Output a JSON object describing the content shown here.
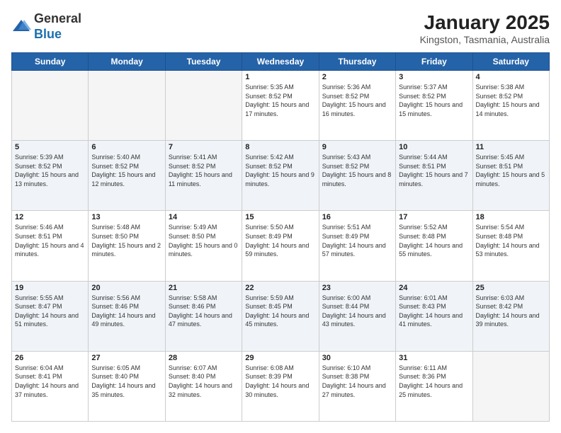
{
  "header": {
    "logo_general": "General",
    "logo_blue": "Blue",
    "title": "January 2025",
    "subtitle": "Kingston, Tasmania, Australia"
  },
  "days_of_week": [
    "Sunday",
    "Monday",
    "Tuesday",
    "Wednesday",
    "Thursday",
    "Friday",
    "Saturday"
  ],
  "weeks": [
    [
      {
        "day": "",
        "empty": true
      },
      {
        "day": "",
        "empty": true
      },
      {
        "day": "",
        "empty": true
      },
      {
        "day": "1",
        "sunrise": "Sunrise: 5:35 AM",
        "sunset": "Sunset: 8:52 PM",
        "daylight": "Daylight: 15 hours and 17 minutes."
      },
      {
        "day": "2",
        "sunrise": "Sunrise: 5:36 AM",
        "sunset": "Sunset: 8:52 PM",
        "daylight": "Daylight: 15 hours and 16 minutes."
      },
      {
        "day": "3",
        "sunrise": "Sunrise: 5:37 AM",
        "sunset": "Sunset: 8:52 PM",
        "daylight": "Daylight: 15 hours and 15 minutes."
      },
      {
        "day": "4",
        "sunrise": "Sunrise: 5:38 AM",
        "sunset": "Sunset: 8:52 PM",
        "daylight": "Daylight: 15 hours and 14 minutes."
      }
    ],
    [
      {
        "day": "5",
        "sunrise": "Sunrise: 5:39 AM",
        "sunset": "Sunset: 8:52 PM",
        "daylight": "Daylight: 15 hours and 13 minutes."
      },
      {
        "day": "6",
        "sunrise": "Sunrise: 5:40 AM",
        "sunset": "Sunset: 8:52 PM",
        "daylight": "Daylight: 15 hours and 12 minutes."
      },
      {
        "day": "7",
        "sunrise": "Sunrise: 5:41 AM",
        "sunset": "Sunset: 8:52 PM",
        "daylight": "Daylight: 15 hours and 11 minutes."
      },
      {
        "day": "8",
        "sunrise": "Sunrise: 5:42 AM",
        "sunset": "Sunset: 8:52 PM",
        "daylight": "Daylight: 15 hours and 9 minutes."
      },
      {
        "day": "9",
        "sunrise": "Sunrise: 5:43 AM",
        "sunset": "Sunset: 8:52 PM",
        "daylight": "Daylight: 15 hours and 8 minutes."
      },
      {
        "day": "10",
        "sunrise": "Sunrise: 5:44 AM",
        "sunset": "Sunset: 8:51 PM",
        "daylight": "Daylight: 15 hours and 7 minutes."
      },
      {
        "day": "11",
        "sunrise": "Sunrise: 5:45 AM",
        "sunset": "Sunset: 8:51 PM",
        "daylight": "Daylight: 15 hours and 5 minutes."
      }
    ],
    [
      {
        "day": "12",
        "sunrise": "Sunrise: 5:46 AM",
        "sunset": "Sunset: 8:51 PM",
        "daylight": "Daylight: 15 hours and 4 minutes."
      },
      {
        "day": "13",
        "sunrise": "Sunrise: 5:48 AM",
        "sunset": "Sunset: 8:50 PM",
        "daylight": "Daylight: 15 hours and 2 minutes."
      },
      {
        "day": "14",
        "sunrise": "Sunrise: 5:49 AM",
        "sunset": "Sunset: 8:50 PM",
        "daylight": "Daylight: 15 hours and 0 minutes."
      },
      {
        "day": "15",
        "sunrise": "Sunrise: 5:50 AM",
        "sunset": "Sunset: 8:49 PM",
        "daylight": "Daylight: 14 hours and 59 minutes."
      },
      {
        "day": "16",
        "sunrise": "Sunrise: 5:51 AM",
        "sunset": "Sunset: 8:49 PM",
        "daylight": "Daylight: 14 hours and 57 minutes."
      },
      {
        "day": "17",
        "sunrise": "Sunrise: 5:52 AM",
        "sunset": "Sunset: 8:48 PM",
        "daylight": "Daylight: 14 hours and 55 minutes."
      },
      {
        "day": "18",
        "sunrise": "Sunrise: 5:54 AM",
        "sunset": "Sunset: 8:48 PM",
        "daylight": "Daylight: 14 hours and 53 minutes."
      }
    ],
    [
      {
        "day": "19",
        "sunrise": "Sunrise: 5:55 AM",
        "sunset": "Sunset: 8:47 PM",
        "daylight": "Daylight: 14 hours and 51 minutes."
      },
      {
        "day": "20",
        "sunrise": "Sunrise: 5:56 AM",
        "sunset": "Sunset: 8:46 PM",
        "daylight": "Daylight: 14 hours and 49 minutes."
      },
      {
        "day": "21",
        "sunrise": "Sunrise: 5:58 AM",
        "sunset": "Sunset: 8:46 PM",
        "daylight": "Daylight: 14 hours and 47 minutes."
      },
      {
        "day": "22",
        "sunrise": "Sunrise: 5:59 AM",
        "sunset": "Sunset: 8:45 PM",
        "daylight": "Daylight: 14 hours and 45 minutes."
      },
      {
        "day": "23",
        "sunrise": "Sunrise: 6:00 AM",
        "sunset": "Sunset: 8:44 PM",
        "daylight": "Daylight: 14 hours and 43 minutes."
      },
      {
        "day": "24",
        "sunrise": "Sunrise: 6:01 AM",
        "sunset": "Sunset: 8:43 PM",
        "daylight": "Daylight: 14 hours and 41 minutes."
      },
      {
        "day": "25",
        "sunrise": "Sunrise: 6:03 AM",
        "sunset": "Sunset: 8:42 PM",
        "daylight": "Daylight: 14 hours and 39 minutes."
      }
    ],
    [
      {
        "day": "26",
        "sunrise": "Sunrise: 6:04 AM",
        "sunset": "Sunset: 8:41 PM",
        "daylight": "Daylight: 14 hours and 37 minutes."
      },
      {
        "day": "27",
        "sunrise": "Sunrise: 6:05 AM",
        "sunset": "Sunset: 8:40 PM",
        "daylight": "Daylight: 14 hours and 35 minutes."
      },
      {
        "day": "28",
        "sunrise": "Sunrise: 6:07 AM",
        "sunset": "Sunset: 8:40 PM",
        "daylight": "Daylight: 14 hours and 32 minutes."
      },
      {
        "day": "29",
        "sunrise": "Sunrise: 6:08 AM",
        "sunset": "Sunset: 8:39 PM",
        "daylight": "Daylight: 14 hours and 30 minutes."
      },
      {
        "day": "30",
        "sunrise": "Sunrise: 6:10 AM",
        "sunset": "Sunset: 8:38 PM",
        "daylight": "Daylight: 14 hours and 27 minutes."
      },
      {
        "day": "31",
        "sunrise": "Sunrise: 6:11 AM",
        "sunset": "Sunset: 8:36 PM",
        "daylight": "Daylight: 14 hours and 25 minutes."
      },
      {
        "day": "",
        "empty": true
      }
    ]
  ]
}
